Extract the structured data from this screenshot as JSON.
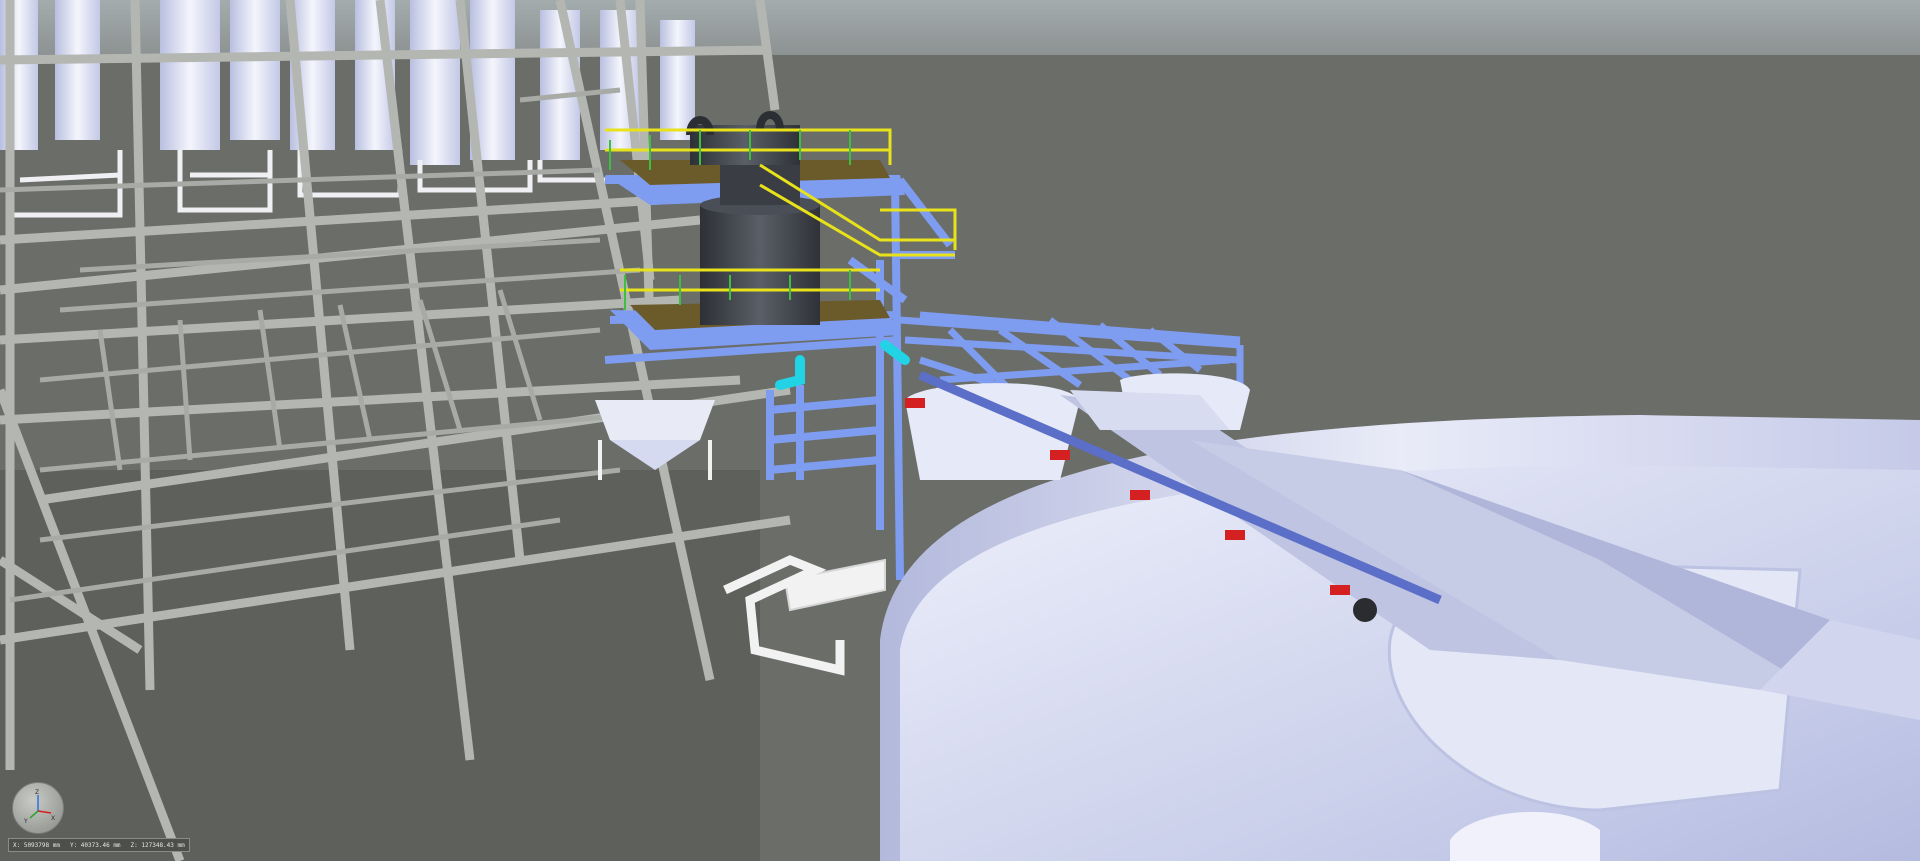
{
  "viewer": {
    "colors": {
      "background": "#6b6d69",
      "sky": "#9aa2a3",
      "floor": "#5f615d",
      "steel_gray": "#b6b8b4",
      "steel_blue": "#7f9df0",
      "railing_yellow": "#e8e21a",
      "railing_green": "#3fbf3f",
      "grating_brown": "#6b5a2a",
      "pipe_cyan": "#22d3e6",
      "tank_white": "#dfe3f4",
      "vessel_dark": "#3c3f45",
      "support_red": "#d42020"
    }
  },
  "axis_gizmo": {
    "labels": [
      "Z",
      "X",
      "Y"
    ]
  },
  "coordinates": {
    "x": "X: 5093798 mm",
    "y": "Y: 40373.46 mm",
    "z": "Z: 127348.43 mm"
  }
}
